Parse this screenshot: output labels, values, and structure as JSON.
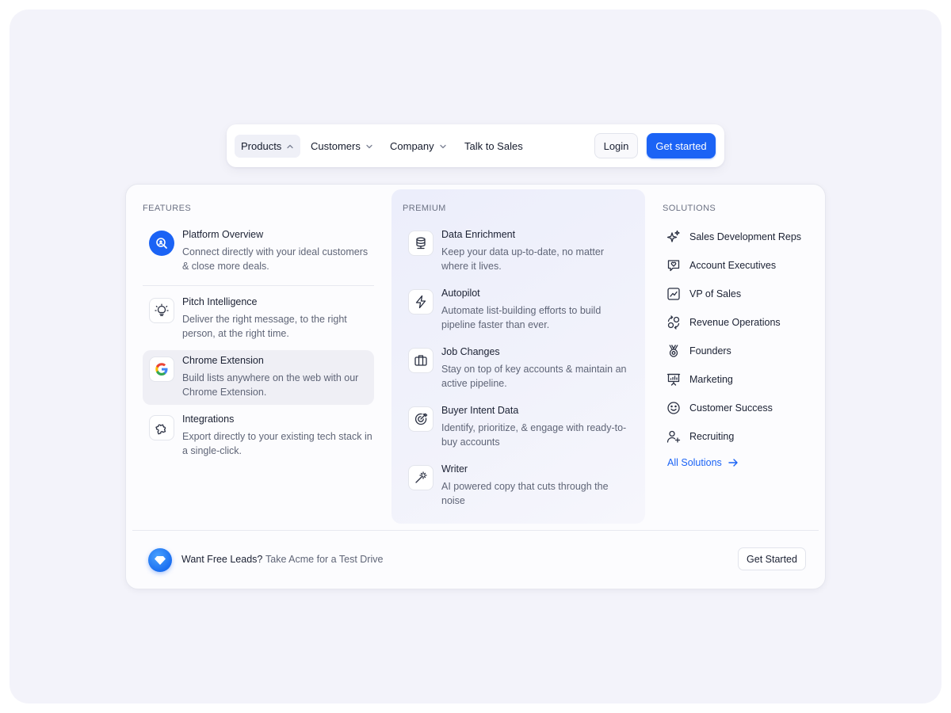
{
  "nav": {
    "items": [
      {
        "label": "Products",
        "icon": "chevron-up-icon",
        "active": true
      },
      {
        "label": "Customers",
        "icon": "chevron-down-icon"
      },
      {
        "label": "Company",
        "icon": "chevron-down-icon"
      },
      {
        "label": "Talk to Sales"
      }
    ],
    "login_label": "Login",
    "get_started_label": "Get started",
    "accent_color": "#1b63f5"
  },
  "menu": {
    "features": {
      "title": "FEATURES",
      "items": [
        {
          "title": "Platform Overview",
          "desc": "Connect directly with your ideal customers & close more deals.",
          "icon": "search-badge-icon"
        },
        {
          "title": "Pitch Intelligence",
          "desc": "Deliver the right message, to the right person, at the right time.",
          "icon": "lightbulb-icon"
        },
        {
          "title": "Chrome Extension",
          "desc": "Build lists anywhere on the web with our Chrome Extension.",
          "icon": "google-icon"
        },
        {
          "title": "Integrations",
          "desc": "Export directly to your existing tech stack in a single-click.",
          "icon": "puzzle-icon"
        }
      ]
    },
    "premium": {
      "title": "PREMIUM",
      "items": [
        {
          "title": "Data Enrichment",
          "desc": "Keep your data up-to-date, no matter where it lives.",
          "icon": "database-icon"
        },
        {
          "title": "Autopilot",
          "desc": "Automate list-building efforts to build pipeline faster than ever.",
          "icon": "lightning-icon"
        },
        {
          "title": "Job Changes",
          "desc": "Stay on top of key accounts & maintain an active pipeline.",
          "icon": "briefcase-icon"
        },
        {
          "title": "Buyer Intent Data",
          "desc": "Identify, prioritize, & engage with ready-to-buy accounts",
          "icon": "target-icon"
        },
        {
          "title": "Writer",
          "desc": "AI powered copy that cuts through the noise",
          "icon": "magic-wand-icon"
        }
      ]
    },
    "solutions": {
      "title": "SOLUTIONS",
      "items": [
        {
          "label": "Sales Development Reps",
          "icon": "sparkles-icon"
        },
        {
          "label": "Account Executives",
          "icon": "chat-heart-icon"
        },
        {
          "label": "VP of Sales",
          "icon": "chart-up-icon"
        },
        {
          "label": "Revenue Operations",
          "icon": "cycle-icon"
        },
        {
          "label": "Founders",
          "icon": "medal-icon"
        },
        {
          "label": "Marketing",
          "icon": "presentation-icon"
        },
        {
          "label": "Customer Success",
          "icon": "smile-icon"
        },
        {
          "label": "Recruiting",
          "icon": "user-plus-icon"
        }
      ],
      "all_label": "All Solutions"
    }
  },
  "promo": {
    "strong": "Want Free Leads?",
    "sub": "Take Acme for a Test Drive",
    "button_label": "Get Started",
    "icon": "diamond-icon"
  }
}
